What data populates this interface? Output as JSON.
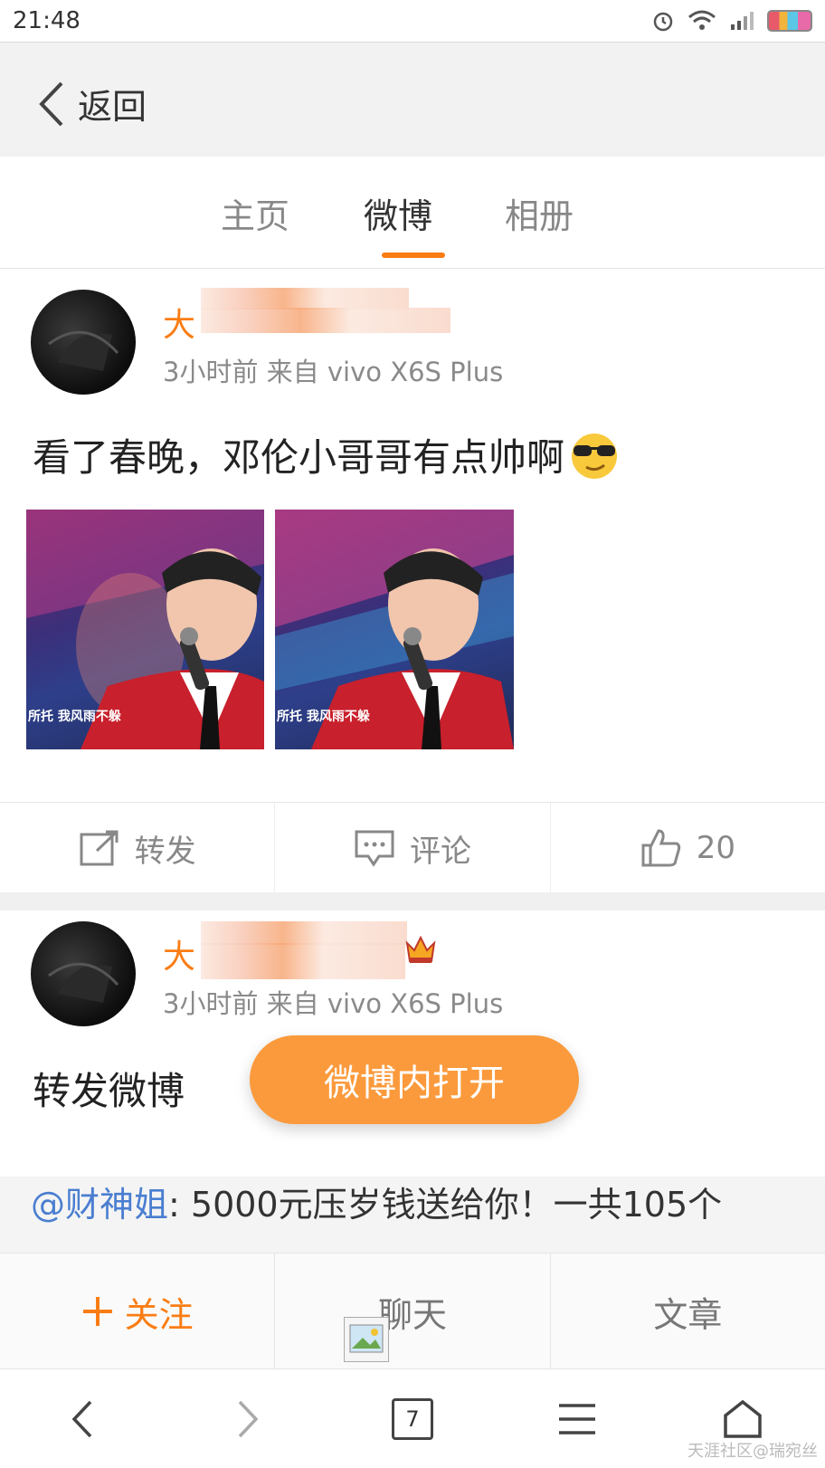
{
  "status_bar": {
    "time": "21:48"
  },
  "header": {
    "back_label": "返回"
  },
  "tabs": [
    {
      "label": "主页"
    },
    {
      "label": "微博"
    },
    {
      "label": "相册"
    }
  ],
  "posts": [
    {
      "username_visible": "大",
      "meta": "3小时前 来自 vivo X6S Plus",
      "text": "看了春晚，邓伦小哥哥有点帅啊",
      "image_captions": [
        "所托 我风雨不躲",
        "所托 我风雨不躲"
      ]
    },
    {
      "username_visible": "大",
      "meta": "3小时前 来自 vivo X6S Plus",
      "text": "转发微博",
      "repost_mention": "@财神姐",
      "repost_text": ": 5000元压岁钱送给你！一共105个"
    }
  ],
  "actions": {
    "repost": "转发",
    "comment": "评论",
    "like_count": "20"
  },
  "open_in_app": "微博内打开",
  "bottom_bar": {
    "follow": "关注",
    "chat": "聊天",
    "article": "文章"
  },
  "browser": {
    "tab_count": "7"
  },
  "watermark": "天涯社区@瑞宛丝",
  "colors": {
    "accent": "#fa7d14",
    "open_button": "#fb9a3c",
    "mention": "#4a7ed0"
  }
}
